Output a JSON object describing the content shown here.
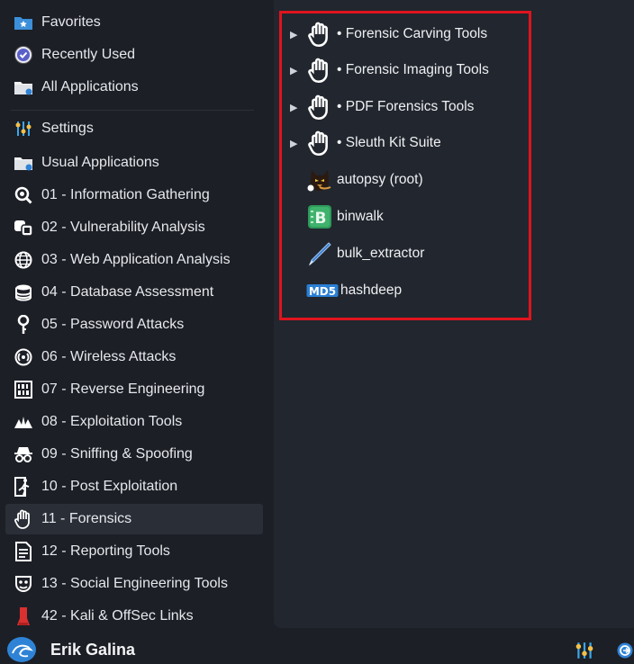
{
  "sidebar": {
    "items": [
      {
        "label": "Favorites",
        "icon": "star-folder-icon"
      },
      {
        "label": "Recently Used",
        "icon": "clock-icon"
      },
      {
        "label": "All Applications",
        "icon": "folder-icon"
      },
      {
        "label": "Settings",
        "icon": "settings-sliders-icon"
      },
      {
        "label": "Usual Applications",
        "icon": "folder-icon"
      },
      {
        "label": "01 - Information Gathering",
        "icon": "magnifier-icon"
      },
      {
        "label": "02 - Vulnerability Analysis",
        "icon": "vulnerability-icon"
      },
      {
        "label": "03 - Web Application Analysis",
        "icon": "globe-icon"
      },
      {
        "label": "04 - Database Assessment",
        "icon": "database-icon"
      },
      {
        "label": "05 - Password Attacks",
        "icon": "key-icon"
      },
      {
        "label": "06 - Wireless Attacks",
        "icon": "wireless-icon"
      },
      {
        "label": "07 - Reverse Engineering",
        "icon": "binary-icon"
      },
      {
        "label": "08 - Exploitation Tools",
        "icon": "exploit-icon"
      },
      {
        "label": "09 - Sniffing & Spoofing",
        "icon": "spy-icon"
      },
      {
        "label": "10 - Post Exploitation",
        "icon": "run-icon"
      },
      {
        "label": "11 - Forensics",
        "icon": "hand-icon"
      },
      {
        "label": "12 - Reporting Tools",
        "icon": "report-icon"
      },
      {
        "label": "13 - Social Engineering Tools",
        "icon": "mask-icon"
      },
      {
        "label": "42 - Kali & OffSec Links",
        "icon": "kali-link-icon"
      }
    ]
  },
  "panel": {
    "items": [
      {
        "label": "• Forensic Carving Tools",
        "icon": "hand-icon",
        "submenu": true
      },
      {
        "label": "• Forensic Imaging Tools",
        "icon": "hand-icon",
        "submenu": true
      },
      {
        "label": "• PDF Forensics Tools",
        "icon": "hand-icon",
        "submenu": true
      },
      {
        "label": "• Sleuth Kit Suite",
        "icon": "hand-icon",
        "submenu": true
      },
      {
        "label": "autopsy (root)",
        "icon": "autopsy-dog-icon",
        "submenu": false
      },
      {
        "label": "binwalk",
        "icon": "binwalk-icon",
        "submenu": false
      },
      {
        "label": "bulk_extractor",
        "icon": "pen-icon",
        "submenu": false
      },
      {
        "label": "hashdeep",
        "icon": "md5-icon",
        "submenu": false
      }
    ],
    "md5_text": "MD5",
    "binwalk_letter": "B"
  },
  "user": {
    "name": "Erik Galina"
  },
  "colors": {
    "highlight": "#e0141e",
    "accent": "#2f83d6",
    "background": "#1c1f26",
    "panel": "#22262e"
  }
}
